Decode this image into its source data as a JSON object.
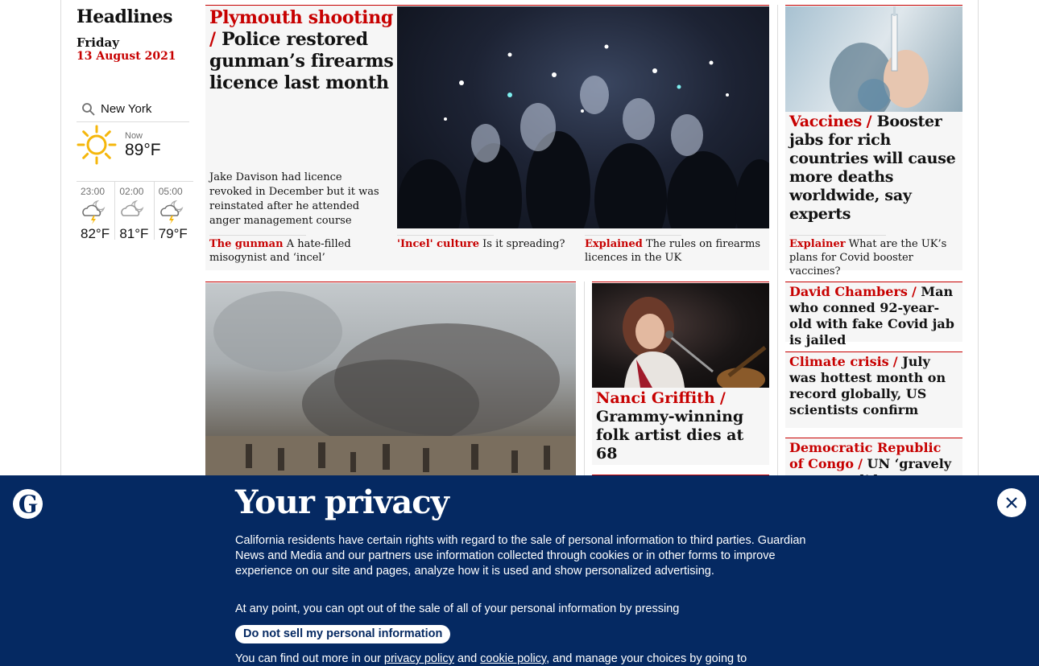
{
  "sidebar": {
    "section_title": "Headlines",
    "day": "Friday",
    "date": "13 August 2021",
    "weather": {
      "location": "New York",
      "now_label": "Now",
      "now_temp": "89°F",
      "now_icon": "sun-icon",
      "forecast": [
        {
          "time": "23:00",
          "temp": "82°F",
          "icon": "thunder-cloud-moon-icon"
        },
        {
          "time": "02:00",
          "temp": "81°F",
          "icon": "cloud-moon-icon"
        },
        {
          "time": "05:00",
          "temp": "79°F",
          "icon": "thunder-cloud-moon-icon"
        }
      ]
    }
  },
  "main_story": {
    "kicker": "Plymouth shooting",
    "headline": "Police restored gunman’s firearms licence last month",
    "standfirst": "Jake Davison had licence revoked in December but it was reinstated after he attended anger management course",
    "sub_links": [
      {
        "kicker": "The gunman",
        "text": "A hate-filled misogynist and ‘incel’"
      },
      {
        "kicker": "'Incel' culture",
        "text": "Is it spreading?"
      },
      {
        "kicker": "Explained",
        "text": "The rules on firearms licences in the UK"
      }
    ]
  },
  "vaccine_story": {
    "kicker": "Vaccines",
    "headline": "Booster jabs for rich countries will cause more deaths worldwide, say experts",
    "explainer_kicker": "Explainer",
    "explainer_text": "What are the UK’s plans for Covid booster vaccines?"
  },
  "nanci_story": {
    "kicker": "Nanci Griffith",
    "headline": "Grammy-winning folk artist dies at 68"
  },
  "small_stories": [
    {
      "kicker": "David Chambers",
      "headline": "Man who conned 92-year-old with fake Covid jab is jailed"
    },
    {
      "kicker": "Climate crisis",
      "headline": "July was hottest month on record globally, US scientists confirm"
    },
    {
      "kicker": "Democratic Republic of Congo",
      "headline": "UN ‘gravely concerned’ by"
    }
  ],
  "consent": {
    "title": "Your privacy",
    "p1": "California residents have certain rights with regard to the sale of personal information to third parties. Guardian News and Media and our partners use information collected through cookies or in other forms to improve experience on our site and pages, analyze how it is used and show personalized advertising.",
    "p2": "At any point, you can opt out of the sale of all of your personal information by pressing",
    "button": "Do not sell my personal information",
    "p3_start": "You can find out more in our",
    "privacy_link": "privacy policy",
    "and": "and",
    "cookie_link": "cookie policy",
    "p3_end": ", and manage your choices by going to"
  },
  "colors": {
    "accent": "#c70000",
    "banner": "#052962"
  }
}
